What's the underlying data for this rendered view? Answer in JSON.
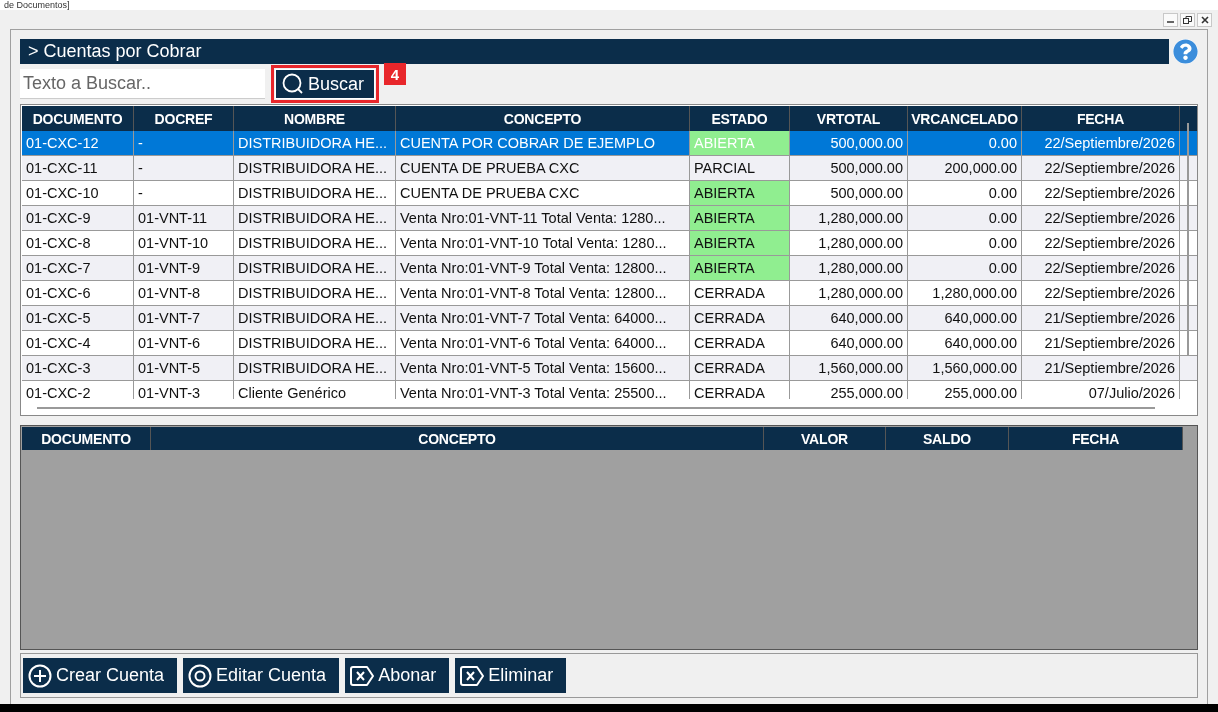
{
  "window": {
    "title": "de Documentos]"
  },
  "header": {
    "title": "> Cuentas por Cobrar"
  },
  "search": {
    "placeholder": "Texto a Buscar..",
    "button": "Buscar",
    "annotation": "4"
  },
  "accounts_table": {
    "columns": [
      "DOCUMENTO",
      "DOCREF",
      "NOMBRE",
      "CONCEPTO",
      "ESTADO",
      "VRTOTAL",
      "VRCANCELADO",
      "FECHA"
    ],
    "rows": [
      {
        "selected": true,
        "highlight": true,
        "cells": [
          "01-CXC-12",
          "-",
          "DISTRIBUIDORA HE...",
          "CUENTA POR COBRAR DE EJEMPLO",
          "ABIERTA",
          "500,000.00",
          "0.00",
          "22/Septiembre/2026"
        ]
      },
      {
        "selected": false,
        "highlight": false,
        "cells": [
          "01-CXC-11",
          "-",
          "DISTRIBUIDORA HE...",
          "CUENTA DE PRUEBA CXC",
          "PARCIAL",
          "500,000.00",
          "200,000.00",
          "22/Septiembre/2026"
        ]
      },
      {
        "selected": false,
        "highlight": true,
        "cells": [
          "01-CXC-10",
          "-",
          "DISTRIBUIDORA HE...",
          "CUENTA DE PRUEBA CXC",
          "ABIERTA",
          "500,000.00",
          "0.00",
          "22/Septiembre/2026"
        ]
      },
      {
        "selected": false,
        "highlight": true,
        "cells": [
          "01-CXC-9",
          "01-VNT-11",
          "DISTRIBUIDORA HE...",
          "Venta Nro:01-VNT-11 Total Venta: 1280...",
          "ABIERTA",
          "1,280,000.00",
          "0.00",
          "22/Septiembre/2026"
        ]
      },
      {
        "selected": false,
        "highlight": true,
        "cells": [
          "01-CXC-8",
          "01-VNT-10",
          "DISTRIBUIDORA HE...",
          "Venta Nro:01-VNT-10 Total Venta: 1280...",
          "ABIERTA",
          "1,280,000.00",
          "0.00",
          "22/Septiembre/2026"
        ]
      },
      {
        "selected": false,
        "highlight": true,
        "cells": [
          "01-CXC-7",
          "01-VNT-9",
          "DISTRIBUIDORA HE...",
          "Venta Nro:01-VNT-9 Total Venta: 12800...",
          "ABIERTA",
          "1,280,000.00",
          "0.00",
          "22/Septiembre/2026"
        ]
      },
      {
        "selected": false,
        "highlight": false,
        "cells": [
          "01-CXC-6",
          "01-VNT-8",
          "DISTRIBUIDORA HE...",
          "Venta Nro:01-VNT-8 Total Venta: 12800...",
          "CERRADA",
          "1,280,000.00",
          "1,280,000.00",
          "22/Septiembre/2026"
        ]
      },
      {
        "selected": false,
        "highlight": false,
        "cells": [
          "01-CXC-5",
          "01-VNT-7",
          "DISTRIBUIDORA HE...",
          "Venta Nro:01-VNT-7 Total Venta: 64000...",
          "CERRADA",
          "640,000.00",
          "640,000.00",
          "21/Septiembre/2026"
        ]
      },
      {
        "selected": false,
        "highlight": false,
        "cells": [
          "01-CXC-4",
          "01-VNT-6",
          "DISTRIBUIDORA HE...",
          "Venta Nro:01-VNT-6 Total Venta: 64000...",
          "CERRADA",
          "640,000.00",
          "640,000.00",
          "21/Septiembre/2026"
        ]
      },
      {
        "selected": false,
        "highlight": false,
        "cells": [
          "01-CXC-3",
          "01-VNT-5",
          "DISTRIBUIDORA HE...",
          "Venta Nro:01-VNT-5 Total Venta: 15600...",
          "CERRADA",
          "1,560,000.00",
          "1,560,000.00",
          "21/Septiembre/2026"
        ]
      },
      {
        "selected": false,
        "highlight": false,
        "cells": [
          "01-CXC-2",
          "01-VNT-3",
          "Cliente Genérico",
          "Venta Nro:01-VNT-3 Total Venta: 25500...",
          "CERRADA",
          "255,000.00",
          "255,000.00",
          "07/Julio/2026"
        ]
      }
    ]
  },
  "detail_table": {
    "columns": [
      "DOCUMENTO",
      "CONCEPTO",
      "VALOR",
      "SALDO",
      "FECHA"
    ]
  },
  "actions": [
    {
      "kind": "add",
      "label": "Crear Cuenta"
    },
    {
      "kind": "view",
      "label": "Editar Cuenta"
    },
    {
      "kind": "remove",
      "label": "Abonar"
    },
    {
      "kind": "remove",
      "label": "Eliminar"
    }
  ]
}
